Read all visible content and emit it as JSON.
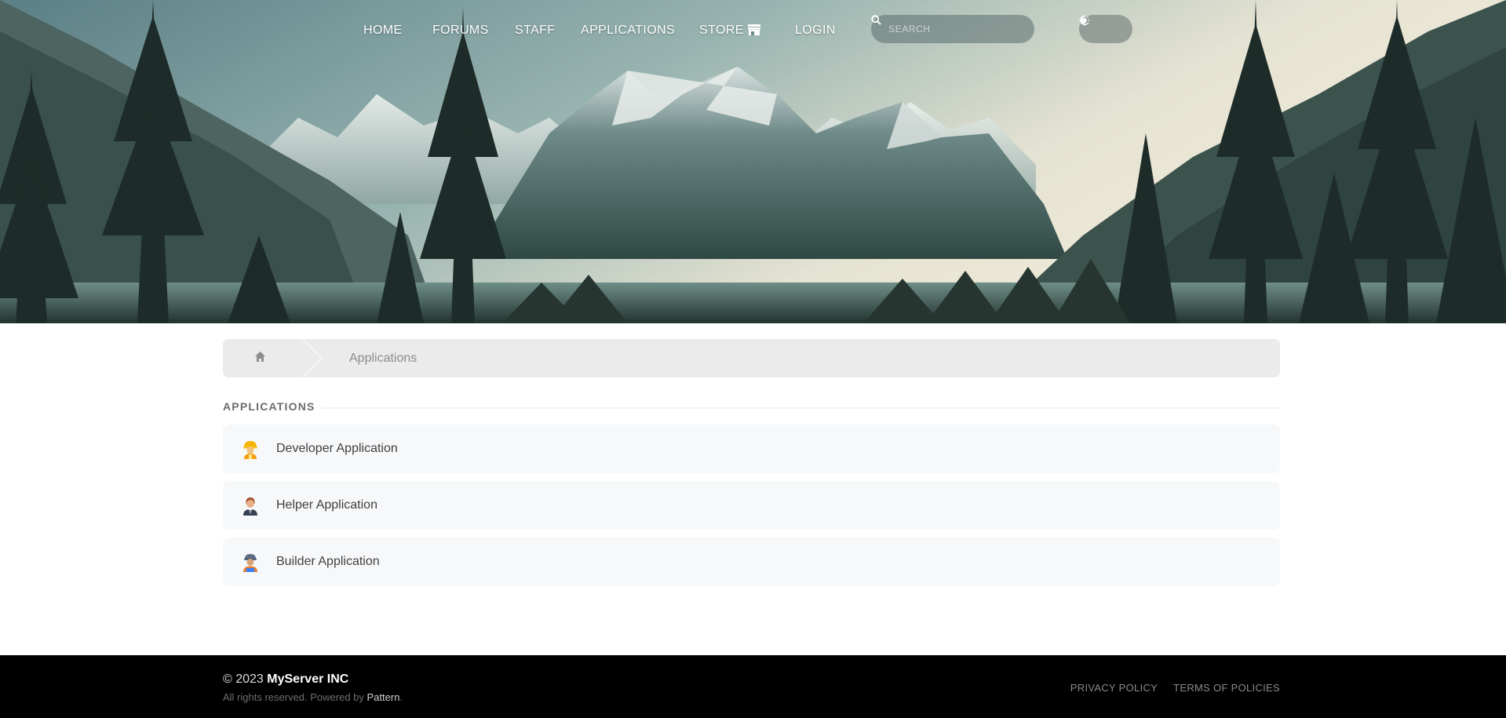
{
  "nav": {
    "items": [
      {
        "label": "HOME"
      },
      {
        "label": "FORUMS"
      },
      {
        "label": "STAFF"
      },
      {
        "label": "APPLICATIONS"
      },
      {
        "label": "STORE"
      },
      {
        "label": "LOGIN"
      }
    ],
    "store_icon": "store-icon",
    "search_placeholder": "SEARCH",
    "search_icon": "search-icon",
    "theme": {
      "dark_icon": "moon-icon",
      "light_icon": "sun-icon"
    }
  },
  "breadcrumb": {
    "home_icon": "home-icon",
    "current": "Applications"
  },
  "section": {
    "title": "APPLICATIONS"
  },
  "applications": [
    {
      "label": "Developer Application",
      "icon": "construction-worker-emoji"
    },
    {
      "label": "Helper Application",
      "icon": "person-in-suit-emoji"
    },
    {
      "label": "Builder Application",
      "icon": "worker-with-cap-emoji"
    }
  ],
  "footer": {
    "copyright_prefix": "© 2023",
    "brand": "MyServer INC",
    "rights_text": "All rights reserved. Powered by",
    "powered_by": "Pattern",
    "period": ".",
    "links": [
      "PRIVACY POLICY",
      "TERMS OF POLICIES"
    ]
  },
  "colors": {
    "breadcrumb_bg": "#ebebeb",
    "card_bg": "#f7f8fa",
    "footer_bg": "#000000"
  }
}
